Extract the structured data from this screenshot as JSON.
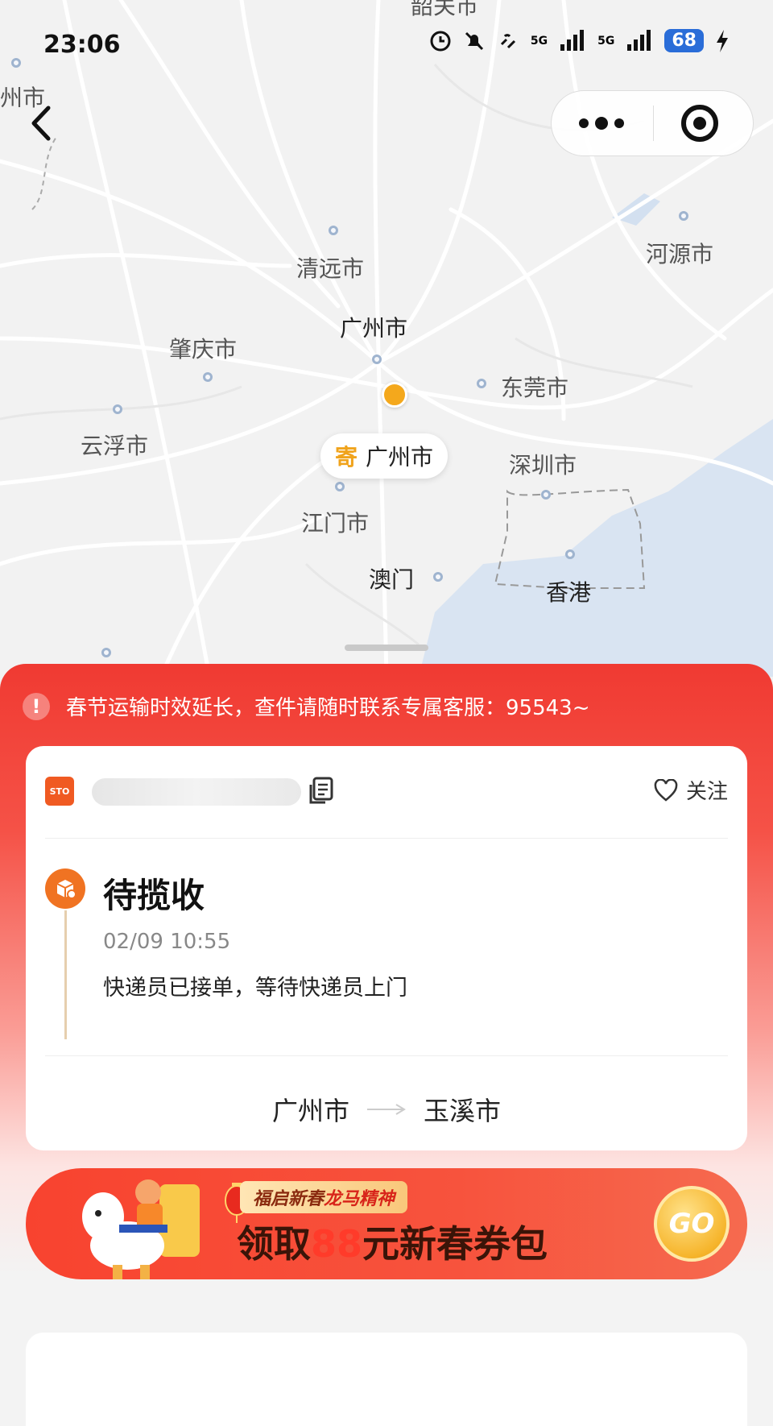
{
  "status_bar": {
    "time": "23:06",
    "battery": "68",
    "network1": "5G",
    "network2": "5G"
  },
  "map": {
    "cities": {
      "guangzhou": "广州市",
      "qingyuan": "清远市",
      "zhaoqing": "肇庆市",
      "yunfu": "云浮市",
      "dongguan": "东莞市",
      "shenzhen": "深圳市",
      "jiangmen": "江门市",
      "macau": "澳门",
      "hongkong": "香港",
      "heyuan": "河源市",
      "shaoguan": "韶关市",
      "partial_left": "州市"
    },
    "origin_pin": {
      "tag": "寄",
      "city": "广州市"
    }
  },
  "notice": {
    "text": "春节运输时效延长，查件请随时联系专属客服：95543~"
  },
  "shipment": {
    "carrier_logo": "STO",
    "follow_label": "关注",
    "status": "待揽收",
    "time": "02/09 10:55",
    "description": "快递员已接单，等待快递员上门",
    "from": "广州市",
    "to": "玉溪市"
  },
  "banner": {
    "tag_prefix": "福启新春",
    "tag_highlight": "龙马精神",
    "headline_pre": "领取",
    "headline_num": "88",
    "headline_post": "元新春券包",
    "go_label": "GO"
  },
  "colors": {
    "accent_red": "#f03a32",
    "brand_orange": "#f07322",
    "pin_yellow": "#f0a31c"
  }
}
